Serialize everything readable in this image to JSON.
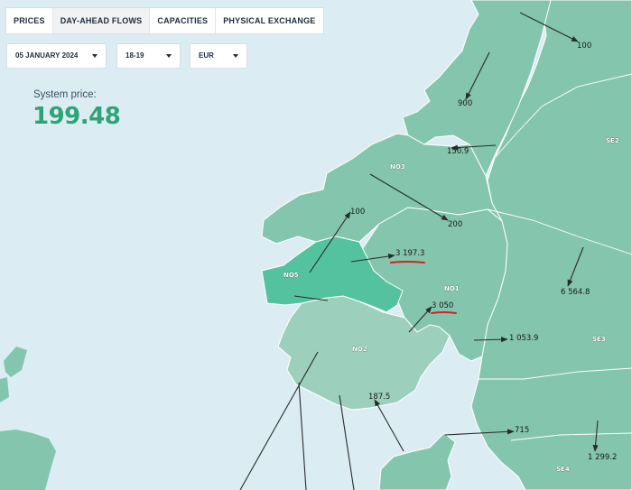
{
  "tabs": [
    {
      "label": "PRICES",
      "active": false
    },
    {
      "label": "DAY-AHEAD FLOWS",
      "active": true
    },
    {
      "label": "CAPACITIES",
      "active": false
    },
    {
      "label": "PHYSICAL EXCHANGE",
      "active": false
    }
  ],
  "filters": {
    "date": "05 JANUARY 2024",
    "hour": "18-19",
    "currency": "EUR"
  },
  "system_price": {
    "label": "System price:",
    "value": "199.48"
  },
  "areas": {
    "no1": "NO1",
    "no2": "NO2",
    "no3": "NO3",
    "no5": "NO5",
    "se2": "SE2",
    "se3": "SE3",
    "se4": "SE4"
  },
  "flows": {
    "f100_top": "100",
    "f900": "900",
    "f150": "150.9",
    "f200": "200",
    "f100_no5": "100",
    "f3197": "3 197.3",
    "f3050": "3 050",
    "f6564": "6 564.8",
    "f1053": "1 053.9",
    "f187": "187.5",
    "f715": "715",
    "f1299": "1 299.2"
  },
  "colors": {
    "sea": "#dbedf3",
    "land": "#84c5ad",
    "no2_land": "#9ccfbc",
    "no5_highlight": "#55c29f",
    "price_green": "#2fa378",
    "underline_red": "#d42020"
  }
}
